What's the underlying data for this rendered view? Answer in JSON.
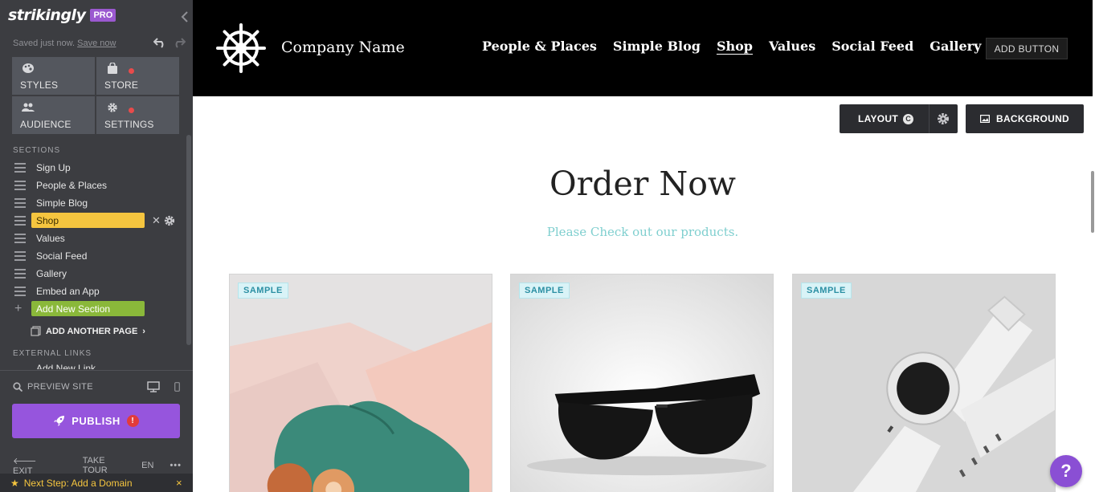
{
  "sidebar": {
    "logo": "strikingly",
    "pro_badge": "PRO",
    "saved_text": "Saved just now.",
    "save_now": "Save now",
    "grid": {
      "styles": "STYLES",
      "store": "STORE",
      "audience": "AUDIENCE",
      "settings": "SETTINGS"
    },
    "sections_title": "SECTIONS",
    "sections": [
      {
        "label": "Sign Up"
      },
      {
        "label": "People & Places"
      },
      {
        "label": "Simple Blog"
      },
      {
        "label": "Shop",
        "active": true
      },
      {
        "label": "Values"
      },
      {
        "label": "Social Feed"
      },
      {
        "label": "Gallery"
      },
      {
        "label": "Embed an App"
      }
    ],
    "add_section": "Add New Section",
    "add_page": "ADD ANOTHER PAGE",
    "external_links_title": "EXTERNAL LINKS",
    "external_link_partial": "Add New Link",
    "preview_site": "PREVIEW SITE",
    "publish": "PUBLISH",
    "publish_alert": "!",
    "footer": {
      "exit": "EXIT",
      "tour": "TAKE TOUR",
      "lang": "EN",
      "more": "•••"
    },
    "next_step": "Next Step: Add a Domain",
    "next_step_close": "×",
    "colors": {
      "active_section": "#f5c53f",
      "add_section": "#8ab83a",
      "publish": "#9655dd",
      "pro": "#9b59d0"
    }
  },
  "site": {
    "company_name": "Company Name",
    "nav": [
      {
        "label": "People & Places"
      },
      {
        "label": "Simple Blog"
      },
      {
        "label": "Shop",
        "active": true
      },
      {
        "label": "Values"
      },
      {
        "label": "Social Feed"
      },
      {
        "label": "Gallery"
      }
    ],
    "nav_more": "...",
    "add_button": "ADD BUTTON",
    "layout_btn": "LAYOUT",
    "layout_badge": "C",
    "background_btn": "BACKGROUND",
    "title": "Order Now",
    "subtitle": "Please Check out our products.",
    "accent_color": "#7fcfcf",
    "products": [
      {
        "badge": "SAMPLE",
        "image": "green-shoe-image"
      },
      {
        "badge": "SAMPLE",
        "image": "sunglasses-image"
      },
      {
        "badge": "SAMPLE",
        "image": "smartwatch-image"
      }
    ],
    "help": "?"
  }
}
